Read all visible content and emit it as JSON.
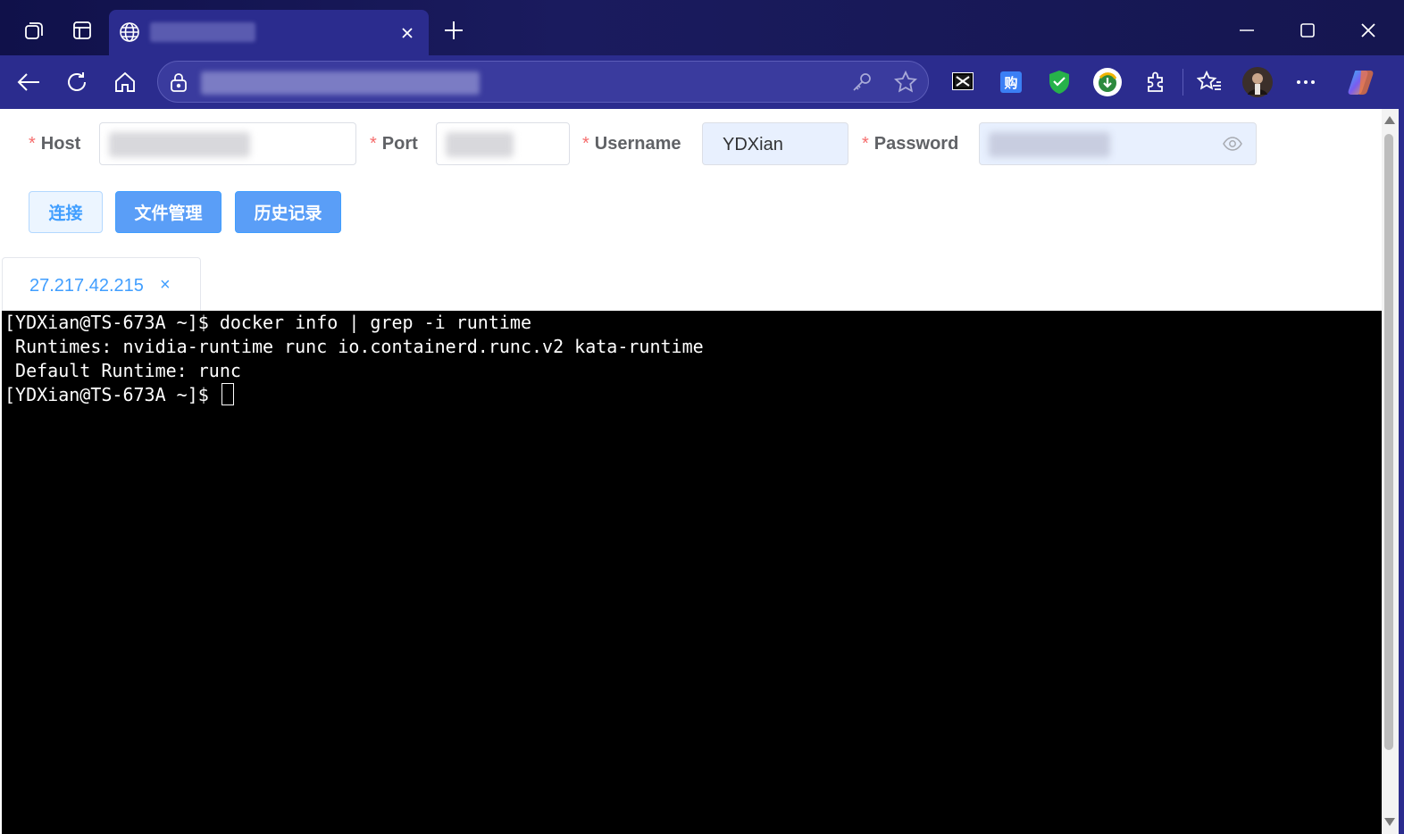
{
  "browser": {
    "tab_icons": [
      "workspaces-icon",
      "vertical-tabs-icon"
    ],
    "tab": {
      "favicon": "globe-icon",
      "close": "×"
    },
    "new_tab": "+",
    "window_controls": [
      "minimize-icon",
      "maximize-icon",
      "close-icon"
    ],
    "nav": [
      "back-icon",
      "refresh-icon",
      "home-icon"
    ],
    "address_icons": [
      "lock-icon",
      "key-icon",
      "favorite-star-icon"
    ],
    "extensions": [
      "screenshot-extension-icon",
      "shopping-extension-icon",
      "shield-extension-icon",
      "idm-extension-icon",
      "puzzle-extensions-icon",
      "favorites-icon",
      "profile-avatar",
      "more-menu-icon",
      "copilot-icon"
    ]
  },
  "form": {
    "required_mark": "*",
    "host_label": "Host",
    "port_label": "Port",
    "username_label": "Username",
    "username_value": "YDXian",
    "password_label": "Password",
    "password_toggle": "eye-icon"
  },
  "buttons": {
    "connect": "连接",
    "file_manager": "文件管理",
    "history": "历史记录"
  },
  "session_tab": {
    "label": "27.217.42.215",
    "close": "×"
  },
  "terminal": {
    "lines": [
      "[YDXian@TS-673A ~]$ docker info | grep -i runtime",
      " Runtimes: nvidia-runtime runc io.containerd.runc.v2 kata-runtime",
      " Default Runtime: runc"
    ],
    "prompt": "[YDXian@TS-673A ~]$ "
  },
  "colors": {
    "accent": "#409eff",
    "required": "#f56c6c",
    "titlebar": "#1a1b5e",
    "toolbar": "#2b2c8e"
  }
}
